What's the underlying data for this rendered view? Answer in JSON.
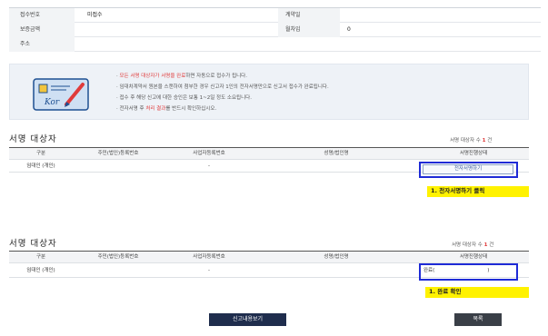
{
  "info": {
    "receipt_no_label": "접수번호",
    "receipt_no_value": "미접수",
    "contract_date_label": "계약일",
    "deposit_label": "보증금액",
    "deposit_value": "",
    "term_label": "월차임",
    "term_value": "0",
    "address_label": "주소"
  },
  "notice": {
    "line1_red": "모든 서명 대상자가 서명을 완료",
    "line1_rest": "하면 자동으로 접수가 됩니다.",
    "line2": "임대차계약서 원본을 스캔하여 첨부한 경우 신고자 1인의 전자서명만으로 신고서 접수가 완료됩니다.",
    "line3": "접수 후 해당 신고에 대한 승인은 보통 1~2일 정도 소요됩니다.",
    "line4_pre": "전자서명 후 ",
    "line4_red": "처리 결과",
    "line4_post": "를 반드시 확인하십시오."
  },
  "section1": {
    "title": "서명 대상자",
    "count_label": "서명 대상자 수",
    "count": "1",
    "count_unit": "건",
    "headers": [
      "구분",
      "주민(법인)등록번호",
      "사업자등록번호",
      "성명/법인명",
      "서명진행상태"
    ],
    "row": {
      "type": "임대인 (개인)",
      "biz_no": "-",
      "sign_button": "전자서명하기"
    },
    "annotation": "1. 전자서명하기 클릭"
  },
  "section2": {
    "title": "서명 대상자",
    "count_label": "서명 대상자 수",
    "count": "1",
    "count_unit": "건",
    "headers": [
      "구분",
      "주민(법인)등록번호",
      "사업자등록번호",
      "성명/법인명",
      "서명진행상태"
    ],
    "row": {
      "type": "임대인 (개인)",
      "biz_no": "-",
      "status": "완료(",
      "status_close": ")"
    },
    "annotation": "1. 완료 확인"
  },
  "buttons": {
    "view_report": "신고내용보기",
    "list": "목록"
  },
  "colors": {
    "accent_red": "#e03b3b",
    "highlight_blue": "#1f2bd6",
    "highlight_yellow": "#fff200",
    "dark_button": "#3a3f47"
  }
}
